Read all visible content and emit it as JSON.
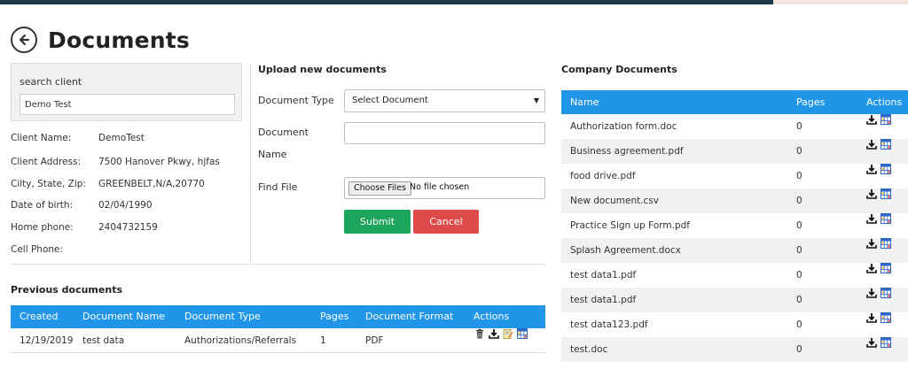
{
  "page": {
    "title": "Documents"
  },
  "search": {
    "label": "search client",
    "value": "Demo Test"
  },
  "client": {
    "rows": [
      {
        "label": "Client Name:",
        "value": "DemoTest"
      },
      {
        "label": "Client Address:",
        "value": "7500 Hanover Pkwy, hjfas"
      },
      {
        "label": "Cilty, State, Zip:",
        "value": "GREENBELT,N/A,20770"
      },
      {
        "label": "Date of birth:",
        "value": "02/04/1990"
      },
      {
        "label": "Home phone:",
        "value": "2404732159"
      },
      {
        "label": "Cell Phone:",
        "value": ""
      }
    ]
  },
  "upload": {
    "title": "Upload new documents",
    "doc_type_label": "Document Type",
    "doc_type_selected": "Select Document",
    "doc_name_label_line1": "Document",
    "doc_name_label_line2": "Name",
    "find_file_label": "Find File",
    "choose_files": "Choose Files",
    "no_file": "No file chosen",
    "submit": "Submit",
    "cancel": "Cancel"
  },
  "previous": {
    "title": "Previous documents",
    "headers": {
      "created": "Created",
      "name": "Document Name",
      "type": "Document Type",
      "pages": "Pages",
      "format": "Document Format",
      "actions": "Actions"
    },
    "rows": [
      {
        "created": "12/19/2019",
        "name": "test data",
        "type": "Authorizations/Referrals",
        "pages": "1",
        "format": "PDF"
      }
    ]
  },
  "company": {
    "title": "Company Documents",
    "headers": {
      "name": "Name",
      "pages": "Pages",
      "actions": "Actions"
    },
    "rows": [
      {
        "name": "Authorization form.doc",
        "pages": "0"
      },
      {
        "name": "Business agreement.pdf",
        "pages": "0"
      },
      {
        "name": "food drive.pdf",
        "pages": "0"
      },
      {
        "name": "New document.csv",
        "pages": "0"
      },
      {
        "name": "Practice Sign up Form.pdf",
        "pages": "0"
      },
      {
        "name": "Splash Agreement.docx",
        "pages": "0"
      },
      {
        "name": "test data1.pdf",
        "pages": "0"
      },
      {
        "name": "test data1.pdf",
        "pages": "0"
      },
      {
        "name": "test data123.pdf",
        "pages": "0"
      },
      {
        "name": "test.doc",
        "pages": "0"
      }
    ]
  },
  "colors": {
    "header_blue": "#2196e8",
    "submit_green": "#1ea55c",
    "cancel_red": "#de4b4b",
    "topbar": "#1c3a4a"
  },
  "icons": {
    "back": "arrow-left-circle-icon",
    "download": "download-icon",
    "view": "grid-view-icon",
    "delete": "trash-icon",
    "edit": "edit-note-icon"
  }
}
